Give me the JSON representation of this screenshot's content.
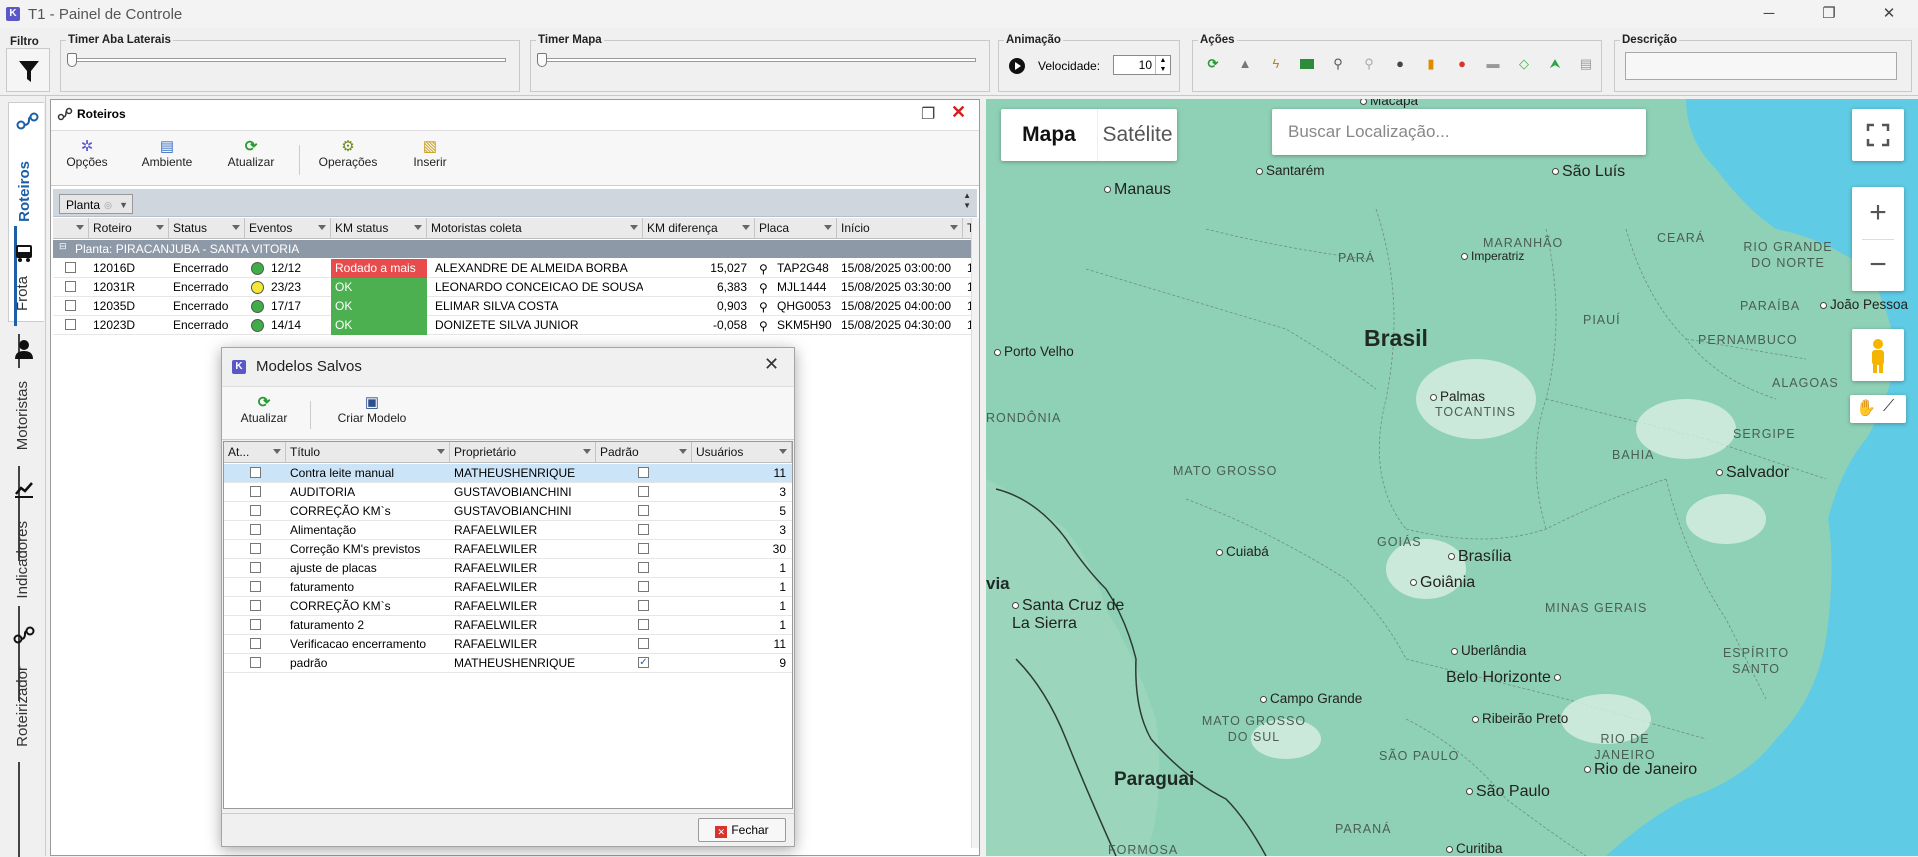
{
  "window": {
    "title": "T1 - Painel de Controle",
    "app_icon": "K",
    "minimize": "─",
    "restore": "❐",
    "close": "✕"
  },
  "topbar": {
    "filtro_label": "Filtro",
    "timer_laterais_label": "Timer Aba Laterais",
    "timer_mapa_label": "Timer Mapa",
    "animacao_label": "Animação",
    "velocidade_label": "Velocidade:",
    "velocidade_value": "10",
    "acoes_label": "Ações",
    "descricao_label": "Descrição",
    "descricao_value": "",
    "acoes_icons": [
      "refresh-icon",
      "warning-triangle-icon",
      "lightning-icon",
      "truck-green-icon",
      "route-icon",
      "route-gray-icon",
      "drop-icon",
      "fuel-pump-icon",
      "alert-red-icon",
      "truck-gray-icon",
      "diamond-icon",
      "arrow-up-icon",
      "printer-icon"
    ]
  },
  "sidebar": {
    "tabs": [
      {
        "label": "Roteiros",
        "icon": "route-icon",
        "active": true
      },
      {
        "label": "Frota",
        "icon": "truck-icon",
        "active": false
      },
      {
        "label": "Motoristas",
        "icon": "driver-icon",
        "active": false
      },
      {
        "label": "Indicadores",
        "icon": "chart-icon",
        "active": false
      },
      {
        "label": "Roteirizador",
        "icon": "route-planner-icon",
        "active": false
      }
    ]
  },
  "roteiros_panel": {
    "title": "Roteiros",
    "toolbar": [
      {
        "label": "Opções",
        "icon": "options-icon"
      },
      {
        "label": "Ambiente",
        "icon": "environment-icon"
      },
      {
        "label": "Atualizar",
        "icon": "refresh-icon"
      },
      {
        "label": "Operações",
        "icon": "operations-icon"
      },
      {
        "label": "Inserir",
        "icon": "insert-icon"
      }
    ],
    "group_chip": "Planta",
    "columns": [
      "Roteiro",
      "Status",
      "Eventos",
      "KM status",
      "Motoristas coleta",
      "KM diferença",
      "Placa",
      "Início",
      "T"
    ],
    "group_row": "Planta: PIRACANJUBA - SANTA VITORIA",
    "rows": [
      {
        "roteiro": "12016D",
        "status": "Encerrado",
        "event_color": "#3fae49",
        "eventos": "12/12",
        "km_status": "Rodado a mais",
        "km_status_color": "#e84b4b",
        "motorista": "ALEXANDRE DE ALMEIDA BORBA",
        "km_dif": "15,027",
        "placa": "TAP2G48",
        "inicio": "15/08/2025 03:00:00",
        "t": "1"
      },
      {
        "roteiro": "12031R",
        "status": "Encerrado",
        "event_color": "#f3e833",
        "eventos": "23/23",
        "km_status": "OK",
        "km_status_color": "#4caf50",
        "motorista": "LEONARDO CONCEICAO DE SOUSA",
        "km_dif": "6,383",
        "placa": "MJL1444",
        "inicio": "15/08/2025 03:30:00",
        "t": "1"
      },
      {
        "roteiro": "12035D",
        "status": "Encerrado",
        "event_color": "#3fae49",
        "eventos": "17/17",
        "km_status": "OK",
        "km_status_color": "#4caf50",
        "motorista": "ELIMAR SILVA COSTA",
        "km_dif": "0,903",
        "placa": "QHG0053",
        "inicio": "15/08/2025 04:00:00",
        "t": "1"
      },
      {
        "roteiro": "12023D",
        "status": "Encerrado",
        "event_color": "#3fae49",
        "eventos": "14/14",
        "km_status": "OK",
        "km_status_color": "#4caf50",
        "motorista": "DONIZETE SILVA JUNIOR",
        "km_dif": "-0,058",
        "placa": "SKM5H90",
        "inicio": "15/08/2025 04:30:00",
        "t": "1"
      }
    ]
  },
  "dialog": {
    "title": "Modelos Salvos",
    "toolbar": [
      {
        "label": "Atualizar",
        "icon": "refresh-icon"
      },
      {
        "label": "Criar Modelo",
        "icon": "save-icon"
      }
    ],
    "columns": [
      "At...",
      "Título",
      "Proprietário",
      "Padrão",
      "Usuários"
    ],
    "rows": [
      {
        "titulo": "Contra leite manual",
        "proprietario": "MATHEUSHENRIQUE",
        "padrao": false,
        "usuarios": "11",
        "selected": true
      },
      {
        "titulo": "AUDITORIA",
        "proprietario": "GUSTAVOBIANCHINI",
        "padrao": false,
        "usuarios": "3"
      },
      {
        "titulo": "CORREÇÃO KM`s",
        "proprietario": "GUSTAVOBIANCHINI",
        "padrao": false,
        "usuarios": "5"
      },
      {
        "titulo": "Alimentação",
        "proprietario": "RAFAELWILER",
        "padrao": false,
        "usuarios": "3"
      },
      {
        "titulo": "Correção KM's previstos",
        "proprietario": "RAFAELWILER",
        "padrao": false,
        "usuarios": "30"
      },
      {
        "titulo": "ajuste de placas",
        "proprietario": "RAFAELWILER",
        "padrao": false,
        "usuarios": "1"
      },
      {
        "titulo": "faturamento",
        "proprietario": "RAFAELWILER",
        "padrao": false,
        "usuarios": "1"
      },
      {
        "titulo": "CORREÇÃO KM`s",
        "proprietario": "RAFAELWILER",
        "padrao": false,
        "usuarios": "1"
      },
      {
        "titulo": "faturamento 2",
        "proprietario": "RAFAELWILER",
        "padrao": false,
        "usuarios": "1"
      },
      {
        "titulo": "Verificacao encerramento",
        "proprietario": "RAFAELWILER",
        "padrao": false,
        "usuarios": "11"
      },
      {
        "titulo": "padrão",
        "proprietario": "MATHEUSHENRIQUE",
        "padrao": true,
        "usuarios": "9"
      }
    ],
    "close_button": "Fechar"
  },
  "map": {
    "tab_mapa": "Mapa",
    "tab_satelite": "Satélite",
    "search_placeholder": "Buscar Localização...",
    "zoom_in": "+",
    "zoom_out": "−",
    "country": "Brasil",
    "cities": [
      "Macapá",
      "Santarém",
      "São Luís",
      "Manaus",
      "Imperatriz",
      "João Pessoa",
      "Porto Velho",
      "Palmas",
      "Salvador",
      "Brasília",
      "Cuiabá",
      "Goiânia",
      "Santa Cruz de La Sierra",
      "Uberlândia",
      "Belo Horizonte",
      "Campo Grande",
      "Ribeirão Preto",
      "Rio de Janeiro",
      "São Paulo",
      "Curitiba"
    ],
    "states": [
      "PARÁ",
      "MARANHÃO",
      "CEARÁ",
      "RIO GRANDE DO NORTE",
      "PARAÍBA",
      "PIAUÍ",
      "PERNAMBUCO",
      "ALAGOAS",
      "RONDÔNIA",
      "TOCANTINS",
      "SERGIPE",
      "MATO GROSSO",
      "BAHIA",
      "GOIÁS",
      "MINAS GERAIS",
      "ESPÍRITO SANTO",
      "MATO GROSSO DO SUL",
      "SÃO PAULO",
      "RIO DE JANEIRO",
      "PARANÁ",
      "FORMOSA"
    ],
    "country_labels": [
      "Paraguai",
      "via"
    ]
  }
}
